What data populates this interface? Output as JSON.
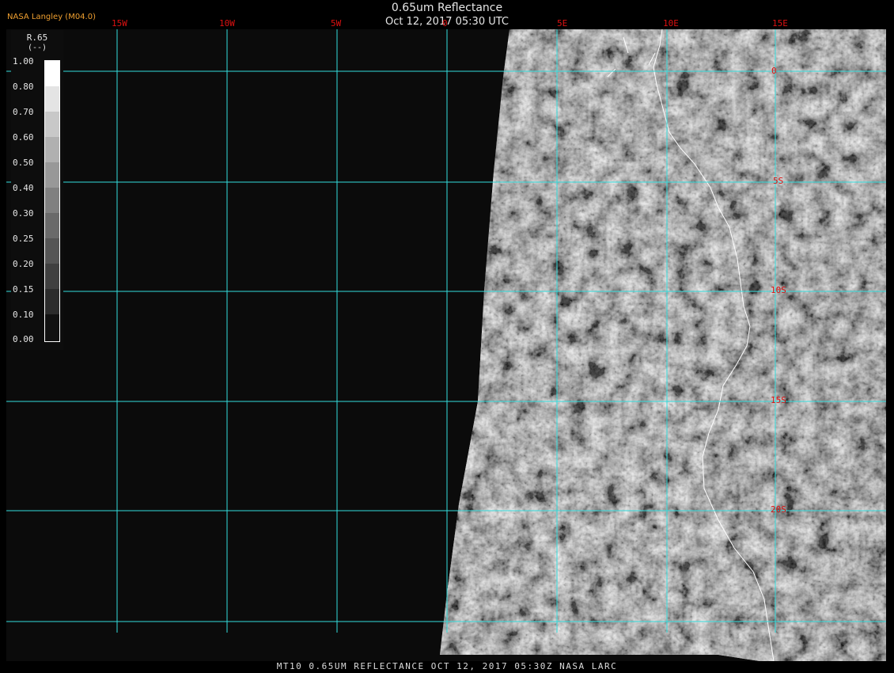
{
  "header": {
    "title": "0.65um Reflectance",
    "datetime": "Oct 12, 2017 05:30 UTC",
    "brand": "NASA Langley (M04.0)"
  },
  "map": {
    "longitude_labels": [
      "15W",
      "10W",
      "5W",
      "0",
      "5E",
      "10E",
      "15E"
    ],
    "latitude_labels": [
      "0",
      "5S",
      "10S",
      "15S",
      "20S"
    ],
    "grid_color": "#33dddd",
    "label_color": "#dd1111",
    "coastline_color": "#ffffff",
    "lon_range": [
      "15W",
      "15E"
    ],
    "lat_range": [
      "0",
      "20S"
    ]
  },
  "colorbar": {
    "title": "R.65",
    "units": "(--)",
    "ticks": [
      "1.00",
      "0.80",
      "0.70",
      "0.60",
      "0.50",
      "0.40",
      "0.30",
      "0.25",
      "0.20",
      "0.15",
      "0.10",
      "0.00"
    ]
  },
  "footer": {
    "text": "MT10  0.65UM REFLECTANCE   OCT 12, 2017 05:30Z   NASA LARC"
  }
}
